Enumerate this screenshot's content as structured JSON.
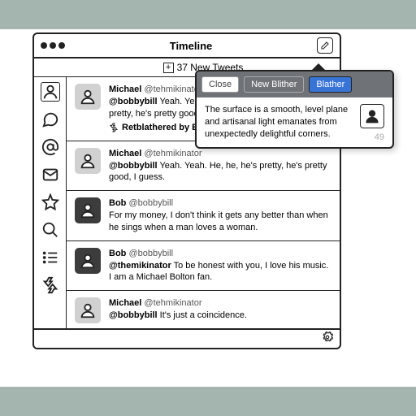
{
  "titlebar": {
    "title": "Timeline"
  },
  "subheader": {
    "count_text": "37 New Tweets"
  },
  "tweets": [
    {
      "author": "Michael",
      "handle": "@tehmikinator",
      "reply_to": "@bobbybill",
      "body": " Yeah. Yeah. ",
      "body2": "pretty, he's pretty good, ",
      "retweet": "Retblathered by Bob",
      "avatar": "light"
    },
    {
      "author": "Michael",
      "handle": "@tehmikinator",
      "reply_to": "@bobbybill",
      "body": " Yeah. Yeah. He, he, he's pretty, he's pretty good, I guess.",
      "avatar": "light"
    },
    {
      "author": "Bob",
      "handle": "@bobbybill",
      "body": "For my money, I don't think it gets any better than when he sings when a man loves a woman.",
      "avatar": "dark"
    },
    {
      "author": "Bob",
      "handle": "@bobbybill",
      "reply_to": "@themikinator",
      "body": " To be honest with you, I love his music. I am a Michael Bolton fan.",
      "avatar": "dark"
    },
    {
      "author": "Michael",
      "handle": "@tehmikinator",
      "reply_to": "@bobbybill",
      "body": " It's just a coincidence.",
      "avatar": "light"
    }
  ],
  "popover": {
    "close": "Close",
    "new": "New Blither",
    "blather": "Blather",
    "text": "The surface is a smooth, level plane and artisanal light emanates from unexpectedly delightful corners.",
    "counter": "49"
  }
}
